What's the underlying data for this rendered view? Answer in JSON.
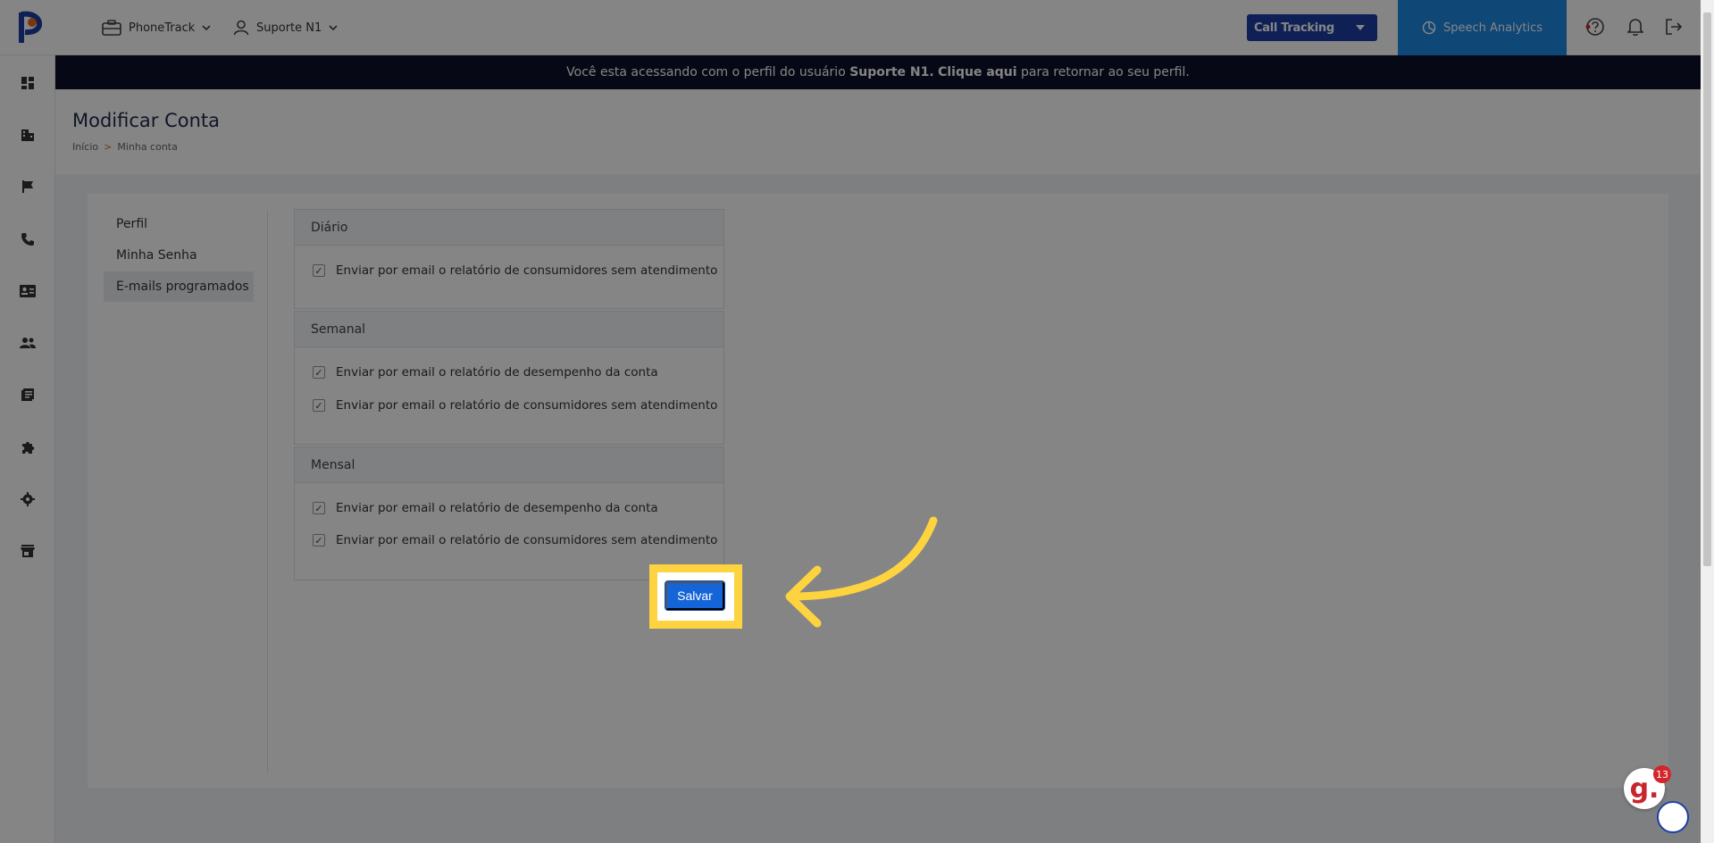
{
  "header": {
    "company_label": "PhoneTrack",
    "user_label": "Suporte N1",
    "product_select": "Call Tracking",
    "speech_label": "Speech Analytics"
  },
  "banner": {
    "prefix": "Você esta acessando com o perfil do usuário",
    "user": "Suporte N1.",
    "link": "Clique aqui",
    "suffix": "para retornar ao seu perfil."
  },
  "page": {
    "title": "Modificar Conta",
    "breadcrumb": [
      "Início",
      ">",
      "Minha conta"
    ]
  },
  "menu": [
    "Perfil",
    "Minha Senha",
    "E-mails programados"
  ],
  "sections": {
    "daily": {
      "title": "Diário",
      "options": [
        "Enviar por email o relatório de consumidores sem atendimento"
      ]
    },
    "weekly": {
      "title": "Semanal",
      "options": [
        "Enviar por email o relatório de desempenho da conta",
        "Enviar por email o relatório de consumidores sem atendimento"
      ]
    },
    "monthly": {
      "title": "Mensal",
      "options": [
        "Enviar por email o relatório de desempenho da conta",
        "Enviar por email o relatório de consumidores sem atendimento"
      ]
    }
  },
  "save_label": "Salvar",
  "widget": {
    "letter": "g.",
    "count": "13"
  },
  "colors": {
    "primary": "#1d3fa6",
    "accent": "#1e88e5",
    "highlight": "#fdd33f",
    "banner": "#0d1229"
  }
}
